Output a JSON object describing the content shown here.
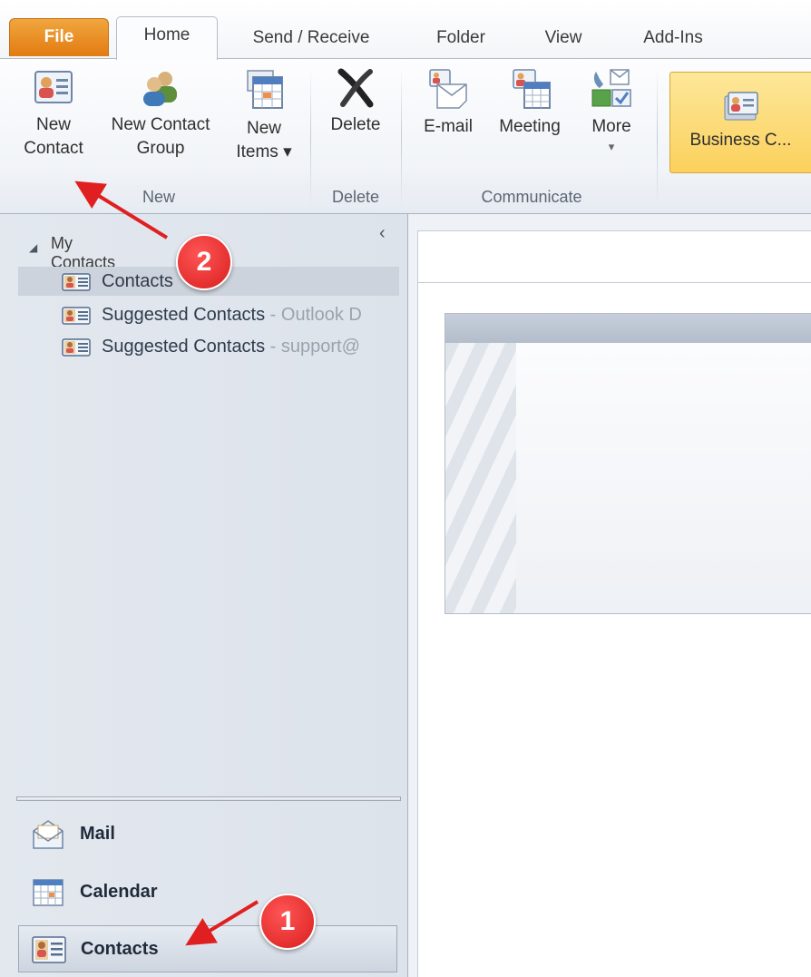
{
  "tabs": [
    "File",
    "Home",
    "Send / Receive",
    "Folder",
    "View",
    "Add-Ins"
  ],
  "ribbon": {
    "new_contact": [
      "New",
      "Contact"
    ],
    "new_contact_group": [
      "New Contact",
      "Group"
    ],
    "new_items": [
      "New",
      "Items ▾"
    ],
    "delete": "Delete",
    "email": "E-mail",
    "meeting": "Meeting",
    "more": [
      "More",
      "▾"
    ],
    "business_card": "Business C...",
    "groups": {
      "new": "New",
      "delete": "Delete",
      "communicate": "Communicate"
    }
  },
  "nav": {
    "header": "My Contacts",
    "collapse_glyph": "‹",
    "folders": [
      {
        "name": "Contacts",
        "sub": ""
      },
      {
        "name": "Suggested Contacts",
        "sub": " - Outlook D"
      },
      {
        "name": "Suggested Contacts",
        "sub": " - support@"
      }
    ],
    "buttons": [
      "Mail",
      "Calendar",
      "Contacts"
    ]
  },
  "annotations": {
    "step1": "1",
    "step2": "2"
  },
  "colors": {
    "file_tab": "#e27b12",
    "selected_button": "#fbd15c",
    "annotation": "#d91e1e"
  }
}
